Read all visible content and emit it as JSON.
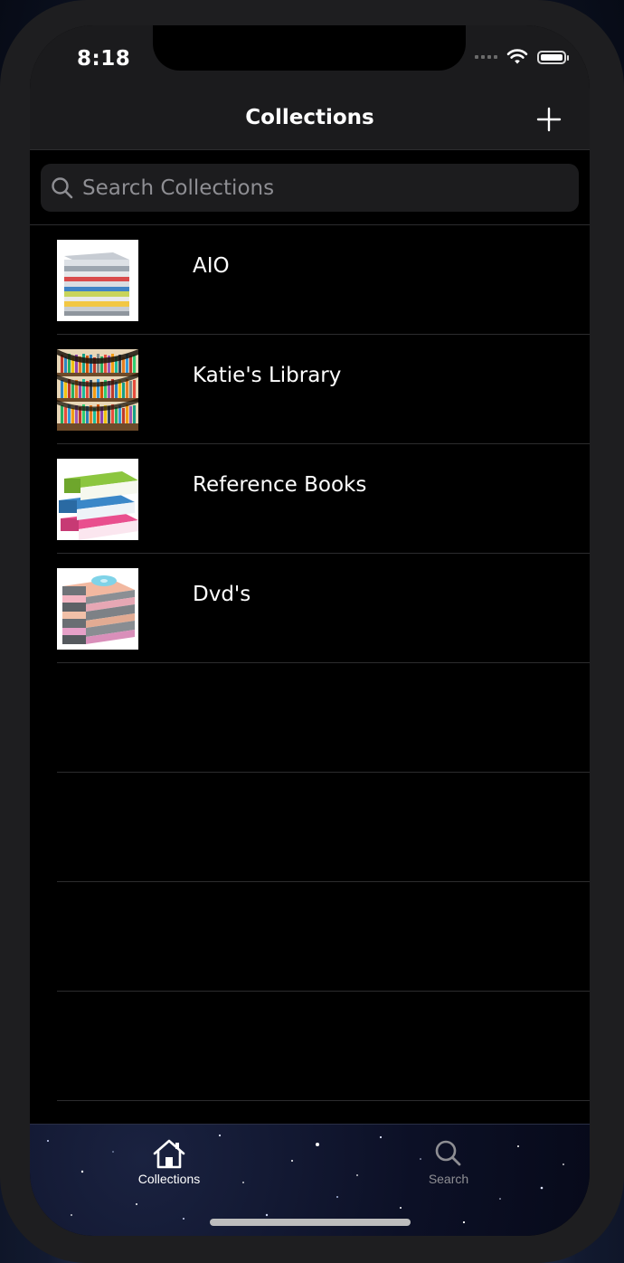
{
  "status_bar": {
    "time": "8:18"
  },
  "nav": {
    "title": "Collections",
    "add_icon": "plus-icon"
  },
  "search": {
    "placeholder": "Search Collections",
    "value": "",
    "icon": "magnifier-icon"
  },
  "collections": [
    {
      "name": "AIO",
      "thumbnail": "stacked-disc-cases"
    },
    {
      "name": "Katie's Library",
      "thumbnail": "curved-bookshelves"
    },
    {
      "name": "Reference Books",
      "thumbnail": "stack-of-books"
    },
    {
      "name": "Dvd's",
      "thumbnail": "stack-of-dvd-cases"
    }
  ],
  "tabs": [
    {
      "label": "Collections",
      "icon": "house-icon",
      "selected": true
    },
    {
      "label": "Search",
      "icon": "magnifier-icon",
      "selected": false
    }
  ],
  "colors": {
    "background": "#000000",
    "bar": "#1b1b1d",
    "text": "#ffffff",
    "placeholder": "#8e8e93",
    "tab_selected": "#ffffff",
    "tab_unselected": "#8e8e93"
  }
}
